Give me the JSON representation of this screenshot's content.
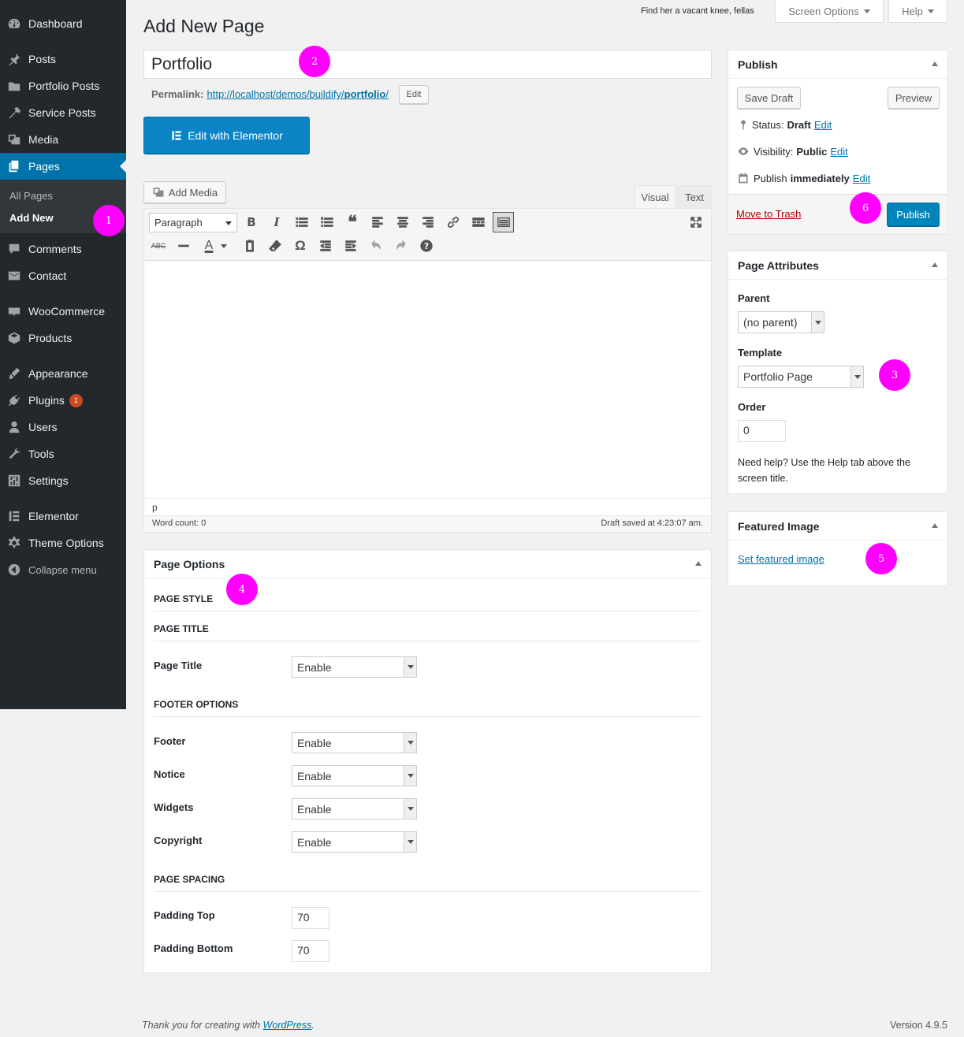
{
  "sidebar": {
    "items": [
      {
        "label": "Dashboard",
        "icon": "dashboard-icon"
      },
      {
        "label": "Posts",
        "icon": "pin-icon"
      },
      {
        "label": "Portfolio Posts",
        "icon": "folder-icon"
      },
      {
        "label": "Service Posts",
        "icon": "hammer-icon"
      },
      {
        "label": "Media",
        "icon": "media-icon"
      },
      {
        "label": "Pages",
        "icon": "pages-icon"
      },
      {
        "label": "Comments",
        "icon": "comment-icon"
      },
      {
        "label": "Contact",
        "icon": "mail-icon"
      },
      {
        "label": "WooCommerce",
        "icon": "woo-icon"
      },
      {
        "label": "Products",
        "icon": "box-icon"
      },
      {
        "label": "Appearance",
        "icon": "brush-icon"
      },
      {
        "label": "Plugins",
        "icon": "plug-icon",
        "badge": "1"
      },
      {
        "label": "Users",
        "icon": "user-icon"
      },
      {
        "label": "Tools",
        "icon": "wrench-icon"
      },
      {
        "label": "Settings",
        "icon": "settings-icon"
      },
      {
        "label": "Elementor",
        "icon": "elementor-icon"
      },
      {
        "label": "Theme Options",
        "icon": "gear-icon"
      },
      {
        "label": "Collapse menu",
        "icon": "collapse-icon"
      }
    ],
    "submenu": {
      "all_pages": "All Pages",
      "add_new": "Add New"
    }
  },
  "top": {
    "hello": "Find her a vacant knee, fellas",
    "screen_options": "Screen Options",
    "help": "Help"
  },
  "page": {
    "heading": "Add New Page",
    "title_value": "Portfolio",
    "permalink_label": "Permalink:",
    "permalink_base": "http://localhost/demos/buildify/",
    "permalink_slug": "portfolio",
    "permalink_end": "/",
    "permalink_edit": "Edit",
    "elementor_button": "Edit with Elementor"
  },
  "editor": {
    "add_media": "Add Media",
    "tab_visual": "Visual",
    "tab_text": "Text",
    "format": "Paragraph",
    "path": "p",
    "word_count": "Word count: 0",
    "draft_saved": "Draft saved at 4:23:07 am."
  },
  "publish": {
    "title": "Publish",
    "save_draft": "Save Draft",
    "preview": "Preview",
    "status_label": "Status:",
    "status_value": "Draft",
    "visibility_label": "Visibility:",
    "visibility_value": "Public",
    "publish_label": "Publish",
    "publish_value": "immediately",
    "edit": "Edit",
    "trash": "Move to Trash",
    "publish_button": "Publish"
  },
  "attributes": {
    "title": "Page Attributes",
    "parent_label": "Parent",
    "parent_value": "(no parent)",
    "template_label": "Template",
    "template_value": "Portfolio Page",
    "order_label": "Order",
    "order_value": "0",
    "help_text": "Need help? Use the Help tab above the screen title."
  },
  "featured": {
    "title": "Featured Image",
    "link": "Set featured image"
  },
  "page_options": {
    "title": "Page Options",
    "page_style": "PAGE STYLE",
    "page_title_head": "PAGE TITLE",
    "page_title_label": "Page Title",
    "page_title_value": "Enable",
    "footer_head": "FOOTER OPTIONS",
    "footer_label": "Footer",
    "footer_value": "Enable",
    "notice_label": "Notice",
    "notice_value": "Enable",
    "widgets_label": "Widgets",
    "widgets_value": "Enable",
    "copyright_label": "Copyright",
    "copyright_value": "Enable",
    "spacing_head": "PAGE SPACING",
    "padding_top_label": "Padding Top",
    "padding_top_value": "70",
    "padding_bottom_label": "Padding Bottom",
    "padding_bottom_value": "70"
  },
  "footer": {
    "thanks": "Thank you for creating with ",
    "wp_link": "WordPress",
    "period": ".",
    "version": "Version 4.9.5"
  },
  "callouts": [
    "1",
    "2",
    "3",
    "4",
    "5",
    "6"
  ],
  "colors": {
    "accent": "#0073aa",
    "callout": "#ff00ff",
    "sidebar": "#23282d",
    "trash": "#a00"
  }
}
